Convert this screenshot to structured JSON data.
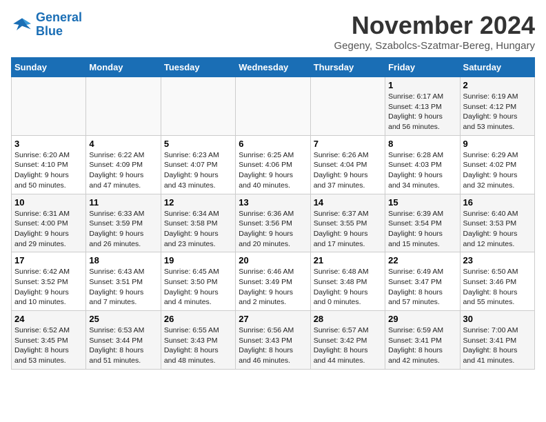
{
  "header": {
    "logo_line1": "General",
    "logo_line2": "Blue",
    "month": "November 2024",
    "location": "Gegeny, Szabolcs-Szatmar-Bereg, Hungary"
  },
  "days_of_week": [
    "Sunday",
    "Monday",
    "Tuesday",
    "Wednesday",
    "Thursday",
    "Friday",
    "Saturday"
  ],
  "weeks": [
    [
      {
        "day": "",
        "info": ""
      },
      {
        "day": "",
        "info": ""
      },
      {
        "day": "",
        "info": ""
      },
      {
        "day": "",
        "info": ""
      },
      {
        "day": "",
        "info": ""
      },
      {
        "day": "1",
        "info": "Sunrise: 6:17 AM\nSunset: 4:13 PM\nDaylight: 9 hours\nand 56 minutes."
      },
      {
        "day": "2",
        "info": "Sunrise: 6:19 AM\nSunset: 4:12 PM\nDaylight: 9 hours\nand 53 minutes."
      }
    ],
    [
      {
        "day": "3",
        "info": "Sunrise: 6:20 AM\nSunset: 4:10 PM\nDaylight: 9 hours\nand 50 minutes."
      },
      {
        "day": "4",
        "info": "Sunrise: 6:22 AM\nSunset: 4:09 PM\nDaylight: 9 hours\nand 47 minutes."
      },
      {
        "day": "5",
        "info": "Sunrise: 6:23 AM\nSunset: 4:07 PM\nDaylight: 9 hours\nand 43 minutes."
      },
      {
        "day": "6",
        "info": "Sunrise: 6:25 AM\nSunset: 4:06 PM\nDaylight: 9 hours\nand 40 minutes."
      },
      {
        "day": "7",
        "info": "Sunrise: 6:26 AM\nSunset: 4:04 PM\nDaylight: 9 hours\nand 37 minutes."
      },
      {
        "day": "8",
        "info": "Sunrise: 6:28 AM\nSunset: 4:03 PM\nDaylight: 9 hours\nand 34 minutes."
      },
      {
        "day": "9",
        "info": "Sunrise: 6:29 AM\nSunset: 4:02 PM\nDaylight: 9 hours\nand 32 minutes."
      }
    ],
    [
      {
        "day": "10",
        "info": "Sunrise: 6:31 AM\nSunset: 4:00 PM\nDaylight: 9 hours\nand 29 minutes."
      },
      {
        "day": "11",
        "info": "Sunrise: 6:33 AM\nSunset: 3:59 PM\nDaylight: 9 hours\nand 26 minutes."
      },
      {
        "day": "12",
        "info": "Sunrise: 6:34 AM\nSunset: 3:58 PM\nDaylight: 9 hours\nand 23 minutes."
      },
      {
        "day": "13",
        "info": "Sunrise: 6:36 AM\nSunset: 3:56 PM\nDaylight: 9 hours\nand 20 minutes."
      },
      {
        "day": "14",
        "info": "Sunrise: 6:37 AM\nSunset: 3:55 PM\nDaylight: 9 hours\nand 17 minutes."
      },
      {
        "day": "15",
        "info": "Sunrise: 6:39 AM\nSunset: 3:54 PM\nDaylight: 9 hours\nand 15 minutes."
      },
      {
        "day": "16",
        "info": "Sunrise: 6:40 AM\nSunset: 3:53 PM\nDaylight: 9 hours\nand 12 minutes."
      }
    ],
    [
      {
        "day": "17",
        "info": "Sunrise: 6:42 AM\nSunset: 3:52 PM\nDaylight: 9 hours\nand 10 minutes."
      },
      {
        "day": "18",
        "info": "Sunrise: 6:43 AM\nSunset: 3:51 PM\nDaylight: 9 hours\nand 7 minutes."
      },
      {
        "day": "19",
        "info": "Sunrise: 6:45 AM\nSunset: 3:50 PM\nDaylight: 9 hours\nand 4 minutes."
      },
      {
        "day": "20",
        "info": "Sunrise: 6:46 AM\nSunset: 3:49 PM\nDaylight: 9 hours\nand 2 minutes."
      },
      {
        "day": "21",
        "info": "Sunrise: 6:48 AM\nSunset: 3:48 PM\nDaylight: 9 hours\nand 0 minutes."
      },
      {
        "day": "22",
        "info": "Sunrise: 6:49 AM\nSunset: 3:47 PM\nDaylight: 8 hours\nand 57 minutes."
      },
      {
        "day": "23",
        "info": "Sunrise: 6:50 AM\nSunset: 3:46 PM\nDaylight: 8 hours\nand 55 minutes."
      }
    ],
    [
      {
        "day": "24",
        "info": "Sunrise: 6:52 AM\nSunset: 3:45 PM\nDaylight: 8 hours\nand 53 minutes."
      },
      {
        "day": "25",
        "info": "Sunrise: 6:53 AM\nSunset: 3:44 PM\nDaylight: 8 hours\nand 51 minutes."
      },
      {
        "day": "26",
        "info": "Sunrise: 6:55 AM\nSunset: 3:43 PM\nDaylight: 8 hours\nand 48 minutes."
      },
      {
        "day": "27",
        "info": "Sunrise: 6:56 AM\nSunset: 3:43 PM\nDaylight: 8 hours\nand 46 minutes."
      },
      {
        "day": "28",
        "info": "Sunrise: 6:57 AM\nSunset: 3:42 PM\nDaylight: 8 hours\nand 44 minutes."
      },
      {
        "day": "29",
        "info": "Sunrise: 6:59 AM\nSunset: 3:41 PM\nDaylight: 8 hours\nand 42 minutes."
      },
      {
        "day": "30",
        "info": "Sunrise: 7:00 AM\nSunset: 3:41 PM\nDaylight: 8 hours\nand 41 minutes."
      }
    ]
  ]
}
